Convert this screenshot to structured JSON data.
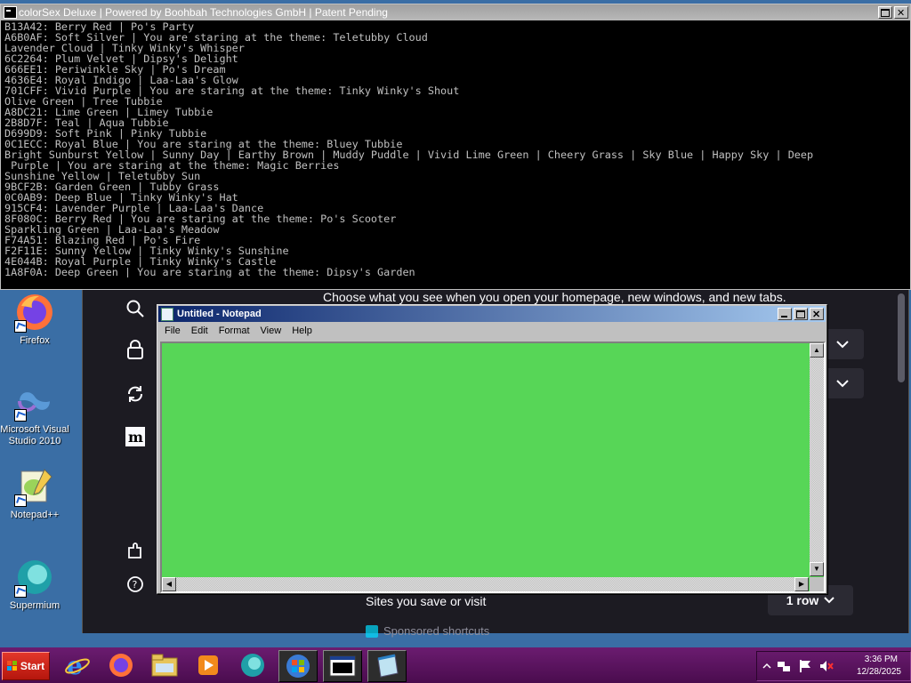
{
  "console": {
    "title": "colorSex Deluxe | Powered by Boohbah Technologies GmbH | Patent Pending",
    "lines": [
      "B13A42: Berry Red | Po's Party",
      "A6B0AF: Soft Silver | You are staring at the theme: Teletubby Cloud",
      "Lavender Cloud | Tinky Winky's Whisper",
      "6C2264: Plum Velvet | Dipsy's Delight",
      "666EE1: Periwinkle Sky | Po's Dream",
      "4636E4: Royal Indigo | Laa-Laa's Glow",
      "701CFF: Vivid Purple | You are staring at the theme: Tinky Winky's Shout",
      "Olive Green | Tree Tubbie",
      "A8DC21: Lime Green | Limey Tubbie",
      "2B8D7F: Teal | Aqua Tubbie",
      "D699D9: Soft Pink | Pinky Tubbie",
      "0C1ECC: Royal Blue | You are staring at the theme: Bluey Tubbie",
      "Bright Sunburst Yellow | Sunny Day | Earthy Brown | Muddy Puddle | Vivid Lime Green | Cheery Grass | Sky Blue | Happy Sky | Deep",
      " Purple | You are staring at the theme: Magic Berries",
      "Sunshine Yellow | Teletubby Sun",
      "9BCF2B: Garden Green | Tubby Grass",
      "0C0AB9: Deep Blue | Tinky Winky's Hat",
      "915CF4: Lavender Purple | Laa-Laa's Dance",
      "8F080C: Berry Red | You are staring at the theme: Po's Scooter",
      "Sparkling Green | Laa-Laa's Meadow",
      "F74A51: Blazing Red | Po's Fire",
      "F2F11E: Sunny Yellow | Tinky Winky's Sunshine",
      "4E044B: Royal Purple | Tinky Winky's Castle",
      "1A8F0A: Deep Green | You are staring at the theme: Dipsy's Garden"
    ],
    "text_color": "#c0c0c0",
    "bg_color": "#000000"
  },
  "firefox_settings": {
    "heading": "Choose what you see when you open your homepage, new windows, and new tabs.",
    "sites_label": "Sites you save or visit",
    "rows_value": "1 row",
    "sponsored_label": "Sponsored shortcuts",
    "icons": [
      "search-icon",
      "lock-icon",
      "sync-icon",
      "mozilla-icon",
      "extensions-icon",
      "help-icon"
    ]
  },
  "notepad": {
    "title": "Untitled - Notepad",
    "menu": [
      "File",
      "Edit",
      "Format",
      "View",
      "Help"
    ],
    "content": "",
    "bg_color": "#57d657"
  },
  "desktop_icons": [
    {
      "label": "Firefox",
      "icon": "firefox-icon"
    },
    {
      "label": "Microsoft Visual Studio 2010",
      "icon": "visual-studio-icon"
    },
    {
      "label": "Notepad++",
      "icon": "notepadpp-icon"
    },
    {
      "label": "Supermium",
      "icon": "supermium-icon"
    }
  ],
  "taskbar": {
    "start_label": "Start",
    "apps": [
      "internet-explorer-icon",
      "firefox-icon",
      "file-explorer-icon",
      "media-player-icon",
      "supermium-icon",
      "windows-icon",
      "console-icon",
      "notepad-icon"
    ],
    "clock_time": "3:36 PM",
    "clock_date": "12/28/2025",
    "bar_color": "#56105a"
  }
}
